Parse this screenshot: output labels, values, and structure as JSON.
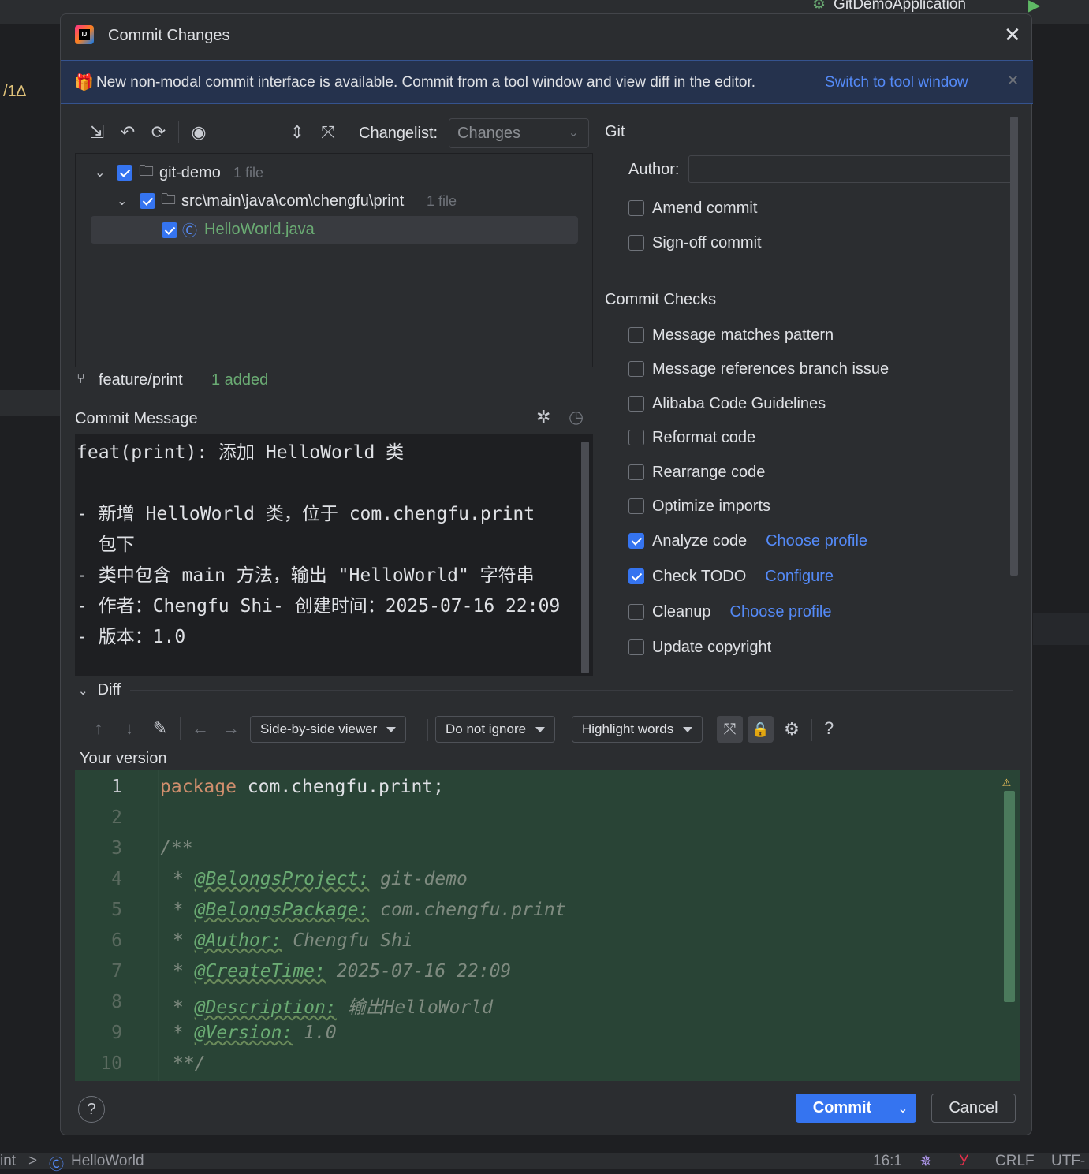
{
  "ide": {
    "run_config": "GitDemoApplication",
    "left_fragment": "/1∆",
    "status": {
      "breadcrumb_left": "int",
      "breadcrumb_sep": ">",
      "breadcrumb_class": "HelloWorld",
      "position": "16:1",
      "line_sep": "CRLF",
      "encoding": "UTF-"
    }
  },
  "dialog": {
    "title": "Commit Changes",
    "banner": {
      "text": "New non-modal commit interface is available. Commit from a tool window and view diff in the editor.",
      "link": "Switch to tool window"
    },
    "changelist": {
      "label": "Changelist:",
      "value": "Changes"
    },
    "tree": [
      {
        "name": "git-demo",
        "meta": "1 file",
        "checked": true
      },
      {
        "name": "src\\main\\java\\com\\chengfu\\print",
        "meta": "1 file",
        "checked": true
      },
      {
        "name": "HelloWorld.java",
        "meta": "",
        "checked": true
      }
    ],
    "branch": "feature/print",
    "branch_status": "1 added",
    "commit_message": {
      "label": "Commit Message",
      "lines": [
        "feat(print): 添加 HelloWorld 类",
        "",
        "- 新增 HelloWorld 类，位于 com.chengfu.print",
        "  包下",
        "- 类中包含 main 方法，输出 \"HelloWorld\" 字符串",
        "- 作者：Chengfu Shi- 创建时间：2025-07-16 22:09",
        "- 版本：1.0"
      ]
    },
    "git": {
      "title": "Git",
      "author_label": "Author:",
      "author_value": "",
      "amend": {
        "label": "Amend commit",
        "checked": false
      },
      "signoff": {
        "label": "Sign-off commit",
        "checked": false
      }
    },
    "checks": {
      "title": "Commit Checks",
      "items": [
        {
          "label": "Message matches pattern",
          "checked": false,
          "link": ""
        },
        {
          "label": "Message references branch issue",
          "checked": false,
          "link": ""
        },
        {
          "label": "Alibaba Code Guidelines",
          "checked": false,
          "link": ""
        },
        {
          "label": "Reformat code",
          "checked": false,
          "link": ""
        },
        {
          "label": "Rearrange code",
          "checked": false,
          "link": ""
        },
        {
          "label": "Optimize imports",
          "checked": false,
          "link": ""
        },
        {
          "label": "Analyze code",
          "checked": true,
          "link": "Choose profile"
        },
        {
          "label": "Check TODO",
          "checked": true,
          "link": "Configure"
        },
        {
          "label": "Cleanup",
          "checked": false,
          "link": "Choose profile"
        },
        {
          "label": "Update copyright",
          "checked": false,
          "link": ""
        }
      ]
    },
    "diff": {
      "title": "Diff",
      "viewer": "Side-by-side viewer",
      "ignore": "Do not ignore",
      "highlight": "Highlight words",
      "help": "?",
      "your_version": "Your version",
      "lines": [
        {
          "n": "1",
          "text": "package com.chengfu.print;"
        },
        {
          "n": "2",
          "text": ""
        },
        {
          "n": "3",
          "text": "/**"
        },
        {
          "n": "4",
          "tag": "@BelongsProject:",
          "val": " git-demo"
        },
        {
          "n": "5",
          "tag": "@BelongsPackage:",
          "val": " com.chengfu.print"
        },
        {
          "n": "6",
          "tag": "@Author:",
          "val": " Chengfu Shi"
        },
        {
          "n": "7",
          "tag": "@CreateTime:",
          "val": " 2025-07-16 22:09"
        },
        {
          "n": "8",
          "tag": "@Description:",
          "val": " 输出HelloWorld"
        },
        {
          "n": "9",
          "tag": "@Version:",
          "val": " 1.0"
        },
        {
          "n": "10",
          "text": "**/"
        }
      ]
    },
    "buttons": {
      "commit": "Commit",
      "cancel": "Cancel",
      "help": "?"
    }
  }
}
